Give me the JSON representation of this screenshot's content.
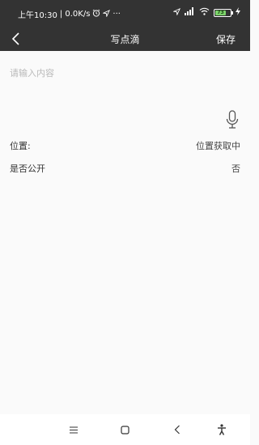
{
  "status_bar": {
    "time": "上午10:30",
    "speed": "| 0.0K/s",
    "more": "···",
    "battery": "73",
    "icons": [
      "alarm-icon",
      "location-arrow-icon",
      "signal-icon",
      "wifi-icon",
      "battery-icon",
      "charging-icon"
    ]
  },
  "header": {
    "title": "写点滴",
    "save_label": "保存",
    "back_icon": "chevron-left-icon"
  },
  "editor": {
    "placeholder": "请输入内容",
    "value": "",
    "mic_icon": "microphone-icon"
  },
  "rows": {
    "location": {
      "label": "位置:",
      "value": "位置获取中"
    },
    "public": {
      "label": "是否公开",
      "value": "否"
    }
  },
  "nav_bar": {
    "icons": [
      "menu-icon",
      "home-square-icon",
      "back-icon",
      "accessibility-icon"
    ]
  },
  "colors": {
    "header_bg": "#333333",
    "page_bg": "#fafafa",
    "battery_green": "#7dd36b",
    "placeholder": "#b9b9b9"
  }
}
